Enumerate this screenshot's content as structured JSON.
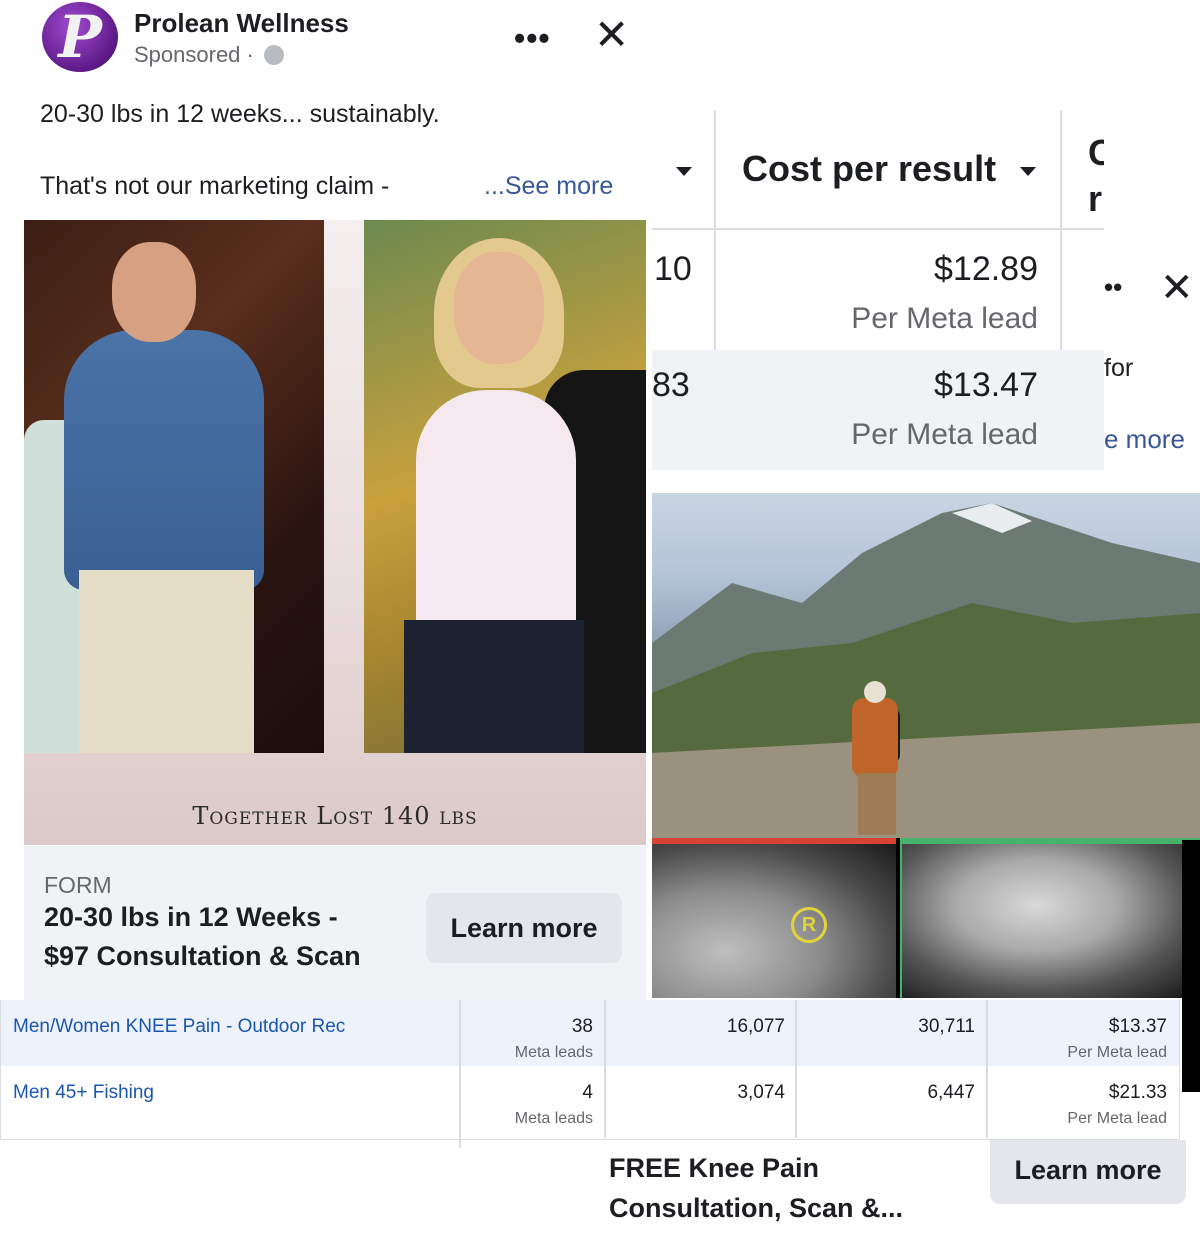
{
  "ad1": {
    "page_name": "Prolean Wellness",
    "logo_letter": "P",
    "sponsored": "Sponsored ·",
    "more_icon": "more-dots-icon",
    "close_icon": "close-icon",
    "more_text": "•••",
    "close_text": "✕",
    "body_line1": "20-30 lbs in 12 weeks... sustainably.",
    "body_line2": "That's not our marketing claim -",
    "see_more": "...See more",
    "image_caption": "Together Lost 140 lbs",
    "cta": {
      "label": "FORM",
      "headline_line1": "20-30 lbs in 12 Weeks -",
      "headline_line2": "$97 Consultation & Scan",
      "button": "Learn more"
    }
  },
  "cost_table": {
    "header": "Cost per result",
    "partial_header_top": "C",
    "partial_header_bottom": "r",
    "rows": [
      {
        "left_fragment": "10",
        "value": "$12.89",
        "sub": "Per Meta lead"
      },
      {
        "left_fragment": "83",
        "value": "$13.47",
        "sub": "Per Meta lead"
      }
    ]
  },
  "ad2_partial": {
    "more_text": "••",
    "close_text": "✕",
    "body_fragment": "for",
    "see_more_fragment": "e more"
  },
  "xray": {
    "marker": "R"
  },
  "ads_table": {
    "rows": [
      {
        "name": "Men/Women KNEE Pain - Outdoor Rec",
        "results": "38",
        "results_sub": "Meta leads",
        "reach": "16,077",
        "impressions": "30,711",
        "cost": "$13.37",
        "cost_sub": "Per Meta lead"
      },
      {
        "name": "Men 45+ Fishing",
        "results": "4",
        "results_sub": "Meta leads",
        "reach": "3,074",
        "impressions": "6,447",
        "cost": "$21.33",
        "cost_sub": "Per Meta lead"
      }
    ]
  },
  "ad2_cta": {
    "headline_line1": "FREE Knee Pain",
    "headline_line2": "Consultation, Scan &...",
    "button": "Learn more"
  },
  "colors": {
    "link_blue": "#385898",
    "table_link": "#1a56b0",
    "button_gray": "#e4e6eb",
    "muted_text": "#65676b"
  }
}
